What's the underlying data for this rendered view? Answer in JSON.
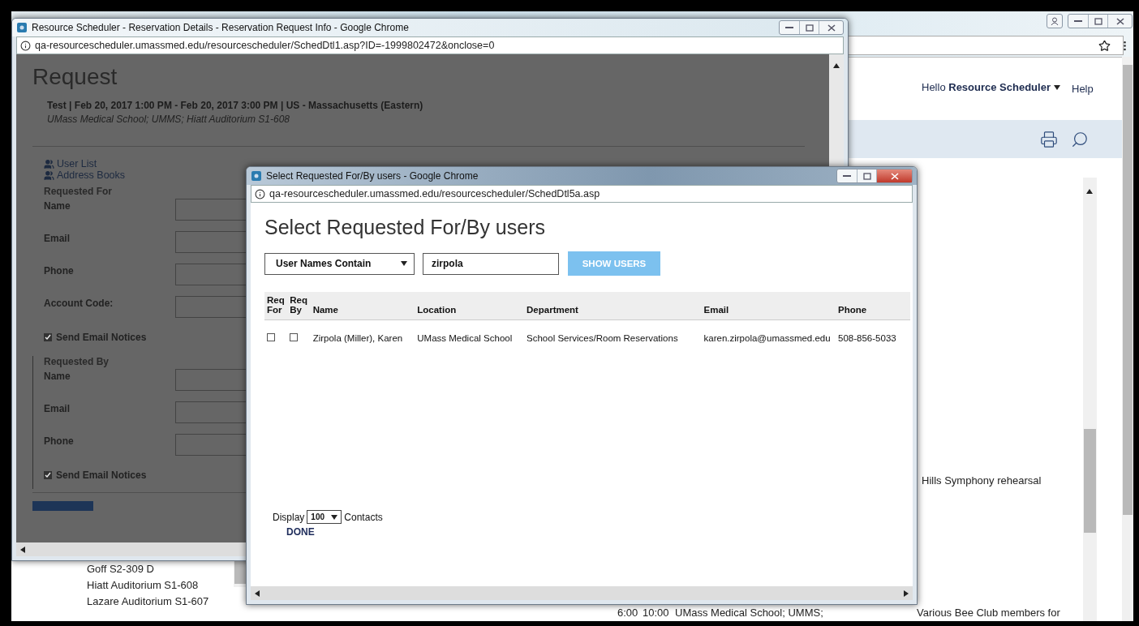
{
  "background_window": {
    "greeting": "Hello",
    "user": "Resource Scheduler",
    "help": "Help",
    "partial_event": "Hills Symphony rehearsal",
    "locations": [
      "Goff S2-309 D",
      "Hiatt Auditorium S1-608",
      "Lazare Auditorium S1-607"
    ],
    "event_row": {
      "start": "6:00",
      "end": "10:00",
      "location": "UMass Medical School; UMMS;",
      "description": "Various Bee Club members for"
    }
  },
  "request_window": {
    "title": "Resource Scheduler - Reservation Details - Reservation Request Info - Google Chrome",
    "url": "qa-resourcescheduler.umassmed.edu/resourcescheduler/SchedDtl1.asp?ID=-1999802472&onclose=0",
    "heading": "Request",
    "summary": "Test | Feb 20, 2017 1:00 PM - Feb 20, 2017 3:00 PM | US - Massachusetts (Eastern)",
    "location": "UMass Medical School; UMMS; Hiatt Auditorium S1-608",
    "links": [
      "User List",
      "Address Books"
    ],
    "sections": [
      {
        "title": "Requested For",
        "fields": [
          "Name",
          "Email",
          "Phone",
          "Account Code:"
        ],
        "send_email": {
          "label": "Send Email Notices",
          "checked": true
        }
      },
      {
        "title": "Requested By",
        "fields": [
          "Name",
          "Email",
          "Phone"
        ],
        "send_email": {
          "label": "Send Email Notices",
          "checked": true
        }
      }
    ]
  },
  "popup": {
    "title": "Select Requested For/By users - Google Chrome",
    "url": "qa-resourcescheduler.umassmed.edu/resourcescheduler/SchedDtl5a.asp",
    "heading": "Select Requested For/By users",
    "filter": "User Names Contain",
    "search": {
      "value": "zirpola"
    },
    "button": "SHOW USERS",
    "columns": [
      "Req For",
      "Req By",
      "Name",
      "Location",
      "Department",
      "Email",
      "Phone"
    ],
    "rows": [
      {
        "req_for": false,
        "req_by": false,
        "name": "Zirpola (Miller), Karen",
        "location": "UMass Medical School",
        "department": "School Services/Room Reservations",
        "email": "karen.zirpola@umassmed.edu",
        "phone": "508-856-5033"
      }
    ],
    "display": {
      "label": "Display",
      "value": "100",
      "suffix": "Contacts"
    },
    "done": "DONE"
  }
}
